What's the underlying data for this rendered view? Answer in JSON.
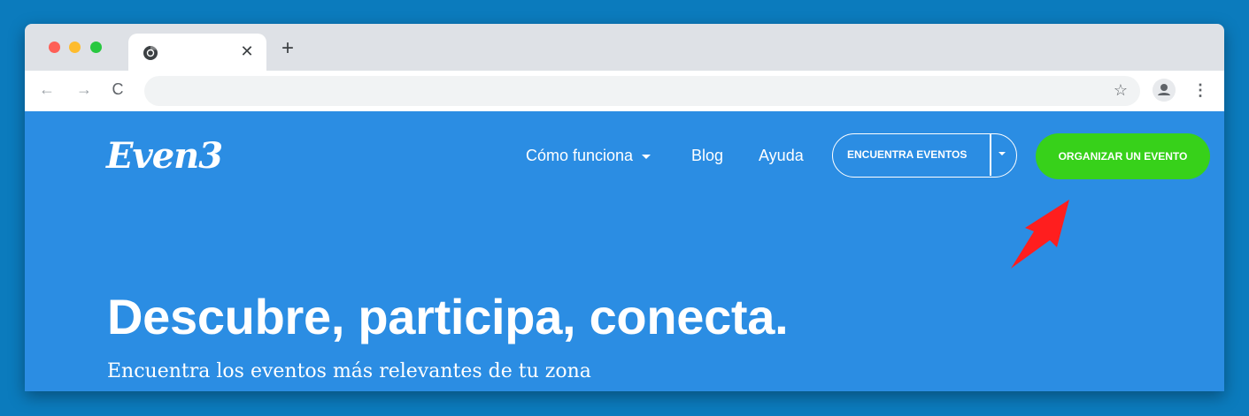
{
  "browser": {
    "tab": {
      "favicon": "chrome-icon",
      "close_label": "✕"
    },
    "new_tab_label": "+",
    "toolbar": {
      "back_icon": "←",
      "forward_icon": "→",
      "reload_icon": "C",
      "omnibox_value": "",
      "star_icon": "☆",
      "menu_icon": "⋮"
    }
  },
  "site": {
    "logo": "Even3",
    "nav": {
      "how_it_works": "Cómo funciona",
      "blog": "Blog",
      "help": "Ayuda",
      "find_events": "ENCUENTRA EVENTOS",
      "organize_event": "ORGANIZAR UN EVENTO"
    },
    "hero": {
      "title": "Descubre, participa, conecta.",
      "subtitle": "Encuentra los eventos más relevantes de tu zona"
    }
  },
  "colors": {
    "page_background": "#0b7bbd",
    "site_blue": "#2b8de3",
    "cta_green": "#37d11a",
    "arrow_red": "#ff1e1e"
  }
}
